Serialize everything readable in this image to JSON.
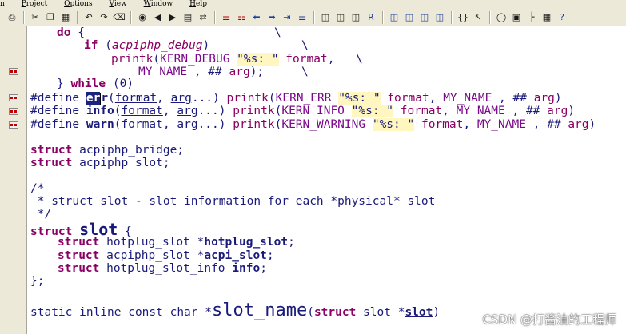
{
  "menu": {
    "items": [
      {
        "label": "n",
        "accel": ""
      },
      {
        "label": "roject",
        "accel": "P"
      },
      {
        "label": "ptions",
        "accel": "O"
      },
      {
        "label": "iew",
        "accel": "V"
      },
      {
        "label": "indow",
        "accel": "W"
      },
      {
        "label": "elp",
        "accel": "H"
      }
    ]
  },
  "toolbar": {
    "groups": [
      [
        "print-icon"
      ],
      [
        "cut-icon",
        "copy-icon",
        "paste-icon"
      ],
      [
        "undo-icon",
        "redo-icon",
        "delete-icon"
      ],
      [
        "binoculars-find-icon",
        "find-prev-icon",
        "find-next-icon",
        "find-in-files-icon",
        "replace-icon"
      ],
      [
        "bookmark-icon",
        "bookmark-clear-icon",
        "back-arrow-icon",
        "forward-arrow-icon",
        "jump-icon",
        "list-icon"
      ],
      [
        "symbol-info-icon",
        "relation-icon",
        "context-icon",
        "r-logo-icon"
      ],
      [
        "window-tile-icon",
        "window-cascade-icon",
        "window-split-icon",
        "window-max-icon"
      ],
      [
        "brace-match-icon",
        "help-cursor-icon"
      ],
      [
        "sync-icon",
        "outline-icon",
        "tree-icon",
        "project-icon",
        "about-icon"
      ]
    ]
  },
  "code": {
    "l1": {
      "kw": "do",
      "rest": " {",
      "bs": "\\"
    },
    "l2": {
      "kw": "if",
      "open": " (",
      "cond": "acpiphp_debug",
      "close": ")",
      "bs": "\\"
    },
    "l3": {
      "fn": "printk",
      "p1": "(",
      "mac": "KERN_DEBUG",
      "sp": " ",
      "str": "\"%s: \"",
      "sp2": " ",
      "arg": "format",
      "comma": ",",
      "bs": "\\"
    },
    "l4": {
      "mac": "MY_NAME",
      "mid": " , ## ",
      "arg": "arg",
      "end": ");",
      "bs": "\\"
    },
    "l5": {
      "brace": "} ",
      "kw": "while",
      "rest": " (0)"
    },
    "l6": {
      "pp": "#define ",
      "sel": "er",
      "name_rest": "r",
      "p": "(",
      "a1": "format",
      "c": ", ",
      "a2": "arg",
      "dots": "...)",
      "fn": "printk",
      "p2": "(",
      "mac": "KERN_ERR",
      "str": "\"%s: \"",
      "arg": "format",
      "comma": ",",
      "mac2": "MY_NAME",
      "mid": " , ## ",
      "arg2": "arg",
      "end": ")"
    },
    "l7": {
      "pp": "#define ",
      "name": "info",
      "p": "(",
      "a1": "format",
      "c": ", ",
      "a2": "arg",
      "dots": "...)",
      "fn": "printk",
      "p2": "(",
      "mac": "KERN_INFO",
      "str": "\"%s: \"",
      "arg": "format",
      "comma": ",",
      "mac2": "MY_NAME",
      "mid": " , ## ",
      "arg2": "arg",
      "end": ")"
    },
    "l8": {
      "pp": "#define ",
      "name": "warn",
      "p": "(",
      "a1": "format",
      "c": ", ",
      "a2": "arg",
      "dots": "...)",
      "fn": "printk",
      "p2": "(",
      "mac": "KERN_WARNING",
      "str": "\"%s: \"",
      "arg": "format",
      "comma": ",",
      "mac2": "MY_NAME",
      "mid": " , ## ",
      "arg2": "arg",
      "end": ")"
    },
    "l9": {
      "kw": "struct",
      "rest": " acpiphp_bridge;"
    },
    "l10": {
      "kw": "struct",
      "rest": " acpiphp_slot;"
    },
    "l11": {
      "text": "/*"
    },
    "l12": {
      "text": " * struct slot - slot information for each *physical* slot"
    },
    "l13": {
      "text": " */"
    },
    "l14": {
      "kw": "struct",
      "name": "slot",
      "rest": " {"
    },
    "l15": {
      "kw": "struct",
      "type": " hotplug_slot *",
      "field": "hotplug_slot",
      "end": ";"
    },
    "l16": {
      "kw": "struct",
      "type": " acpiphp_slot *",
      "field": "acpi_slot",
      "end": ";"
    },
    "l17": {
      "kw": "struct",
      "type": " hotplug_slot_info ",
      "field": "info",
      "end": ";"
    },
    "l18": {
      "text": "};"
    },
    "l19": {
      "pre": "static inline const char *",
      "fn": "slot_name",
      "p": "(",
      "kw": "struct",
      "type": " slot *",
      "arg": "slot",
      "end": ")"
    }
  },
  "watermark": "CSDN @打酱油的工程师"
}
